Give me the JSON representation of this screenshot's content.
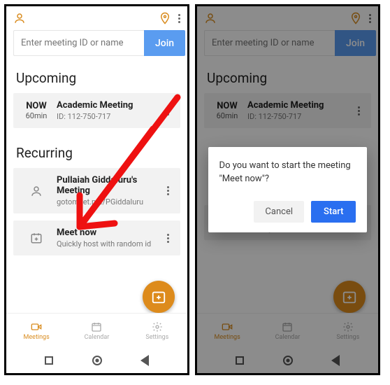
{
  "header": {
    "search_placeholder": "Enter meeting ID or name",
    "join_label": "Join"
  },
  "sections": {
    "upcoming_title": "Upcoming",
    "recurring_title": "Recurring"
  },
  "upcoming": {
    "when_label": "NOW",
    "duration": "60min",
    "title": "Academic Meeting",
    "meeting_id": "ID: 112-750-717"
  },
  "recurring": {
    "item1_title": "Pullaiah Giddaluru's Meeting",
    "item1_sub": "gotomeet.me/PGiddaluru",
    "item2_title": "Meet now",
    "item2_sub": "Quickly host with random id"
  },
  "tabs": {
    "t1": "Meetings",
    "t2": "Calendar",
    "t3": "Settings"
  },
  "dialog": {
    "message": "Do you want to start the meeting \"Meet now\"?",
    "cancel": "Cancel",
    "start": "Start"
  }
}
